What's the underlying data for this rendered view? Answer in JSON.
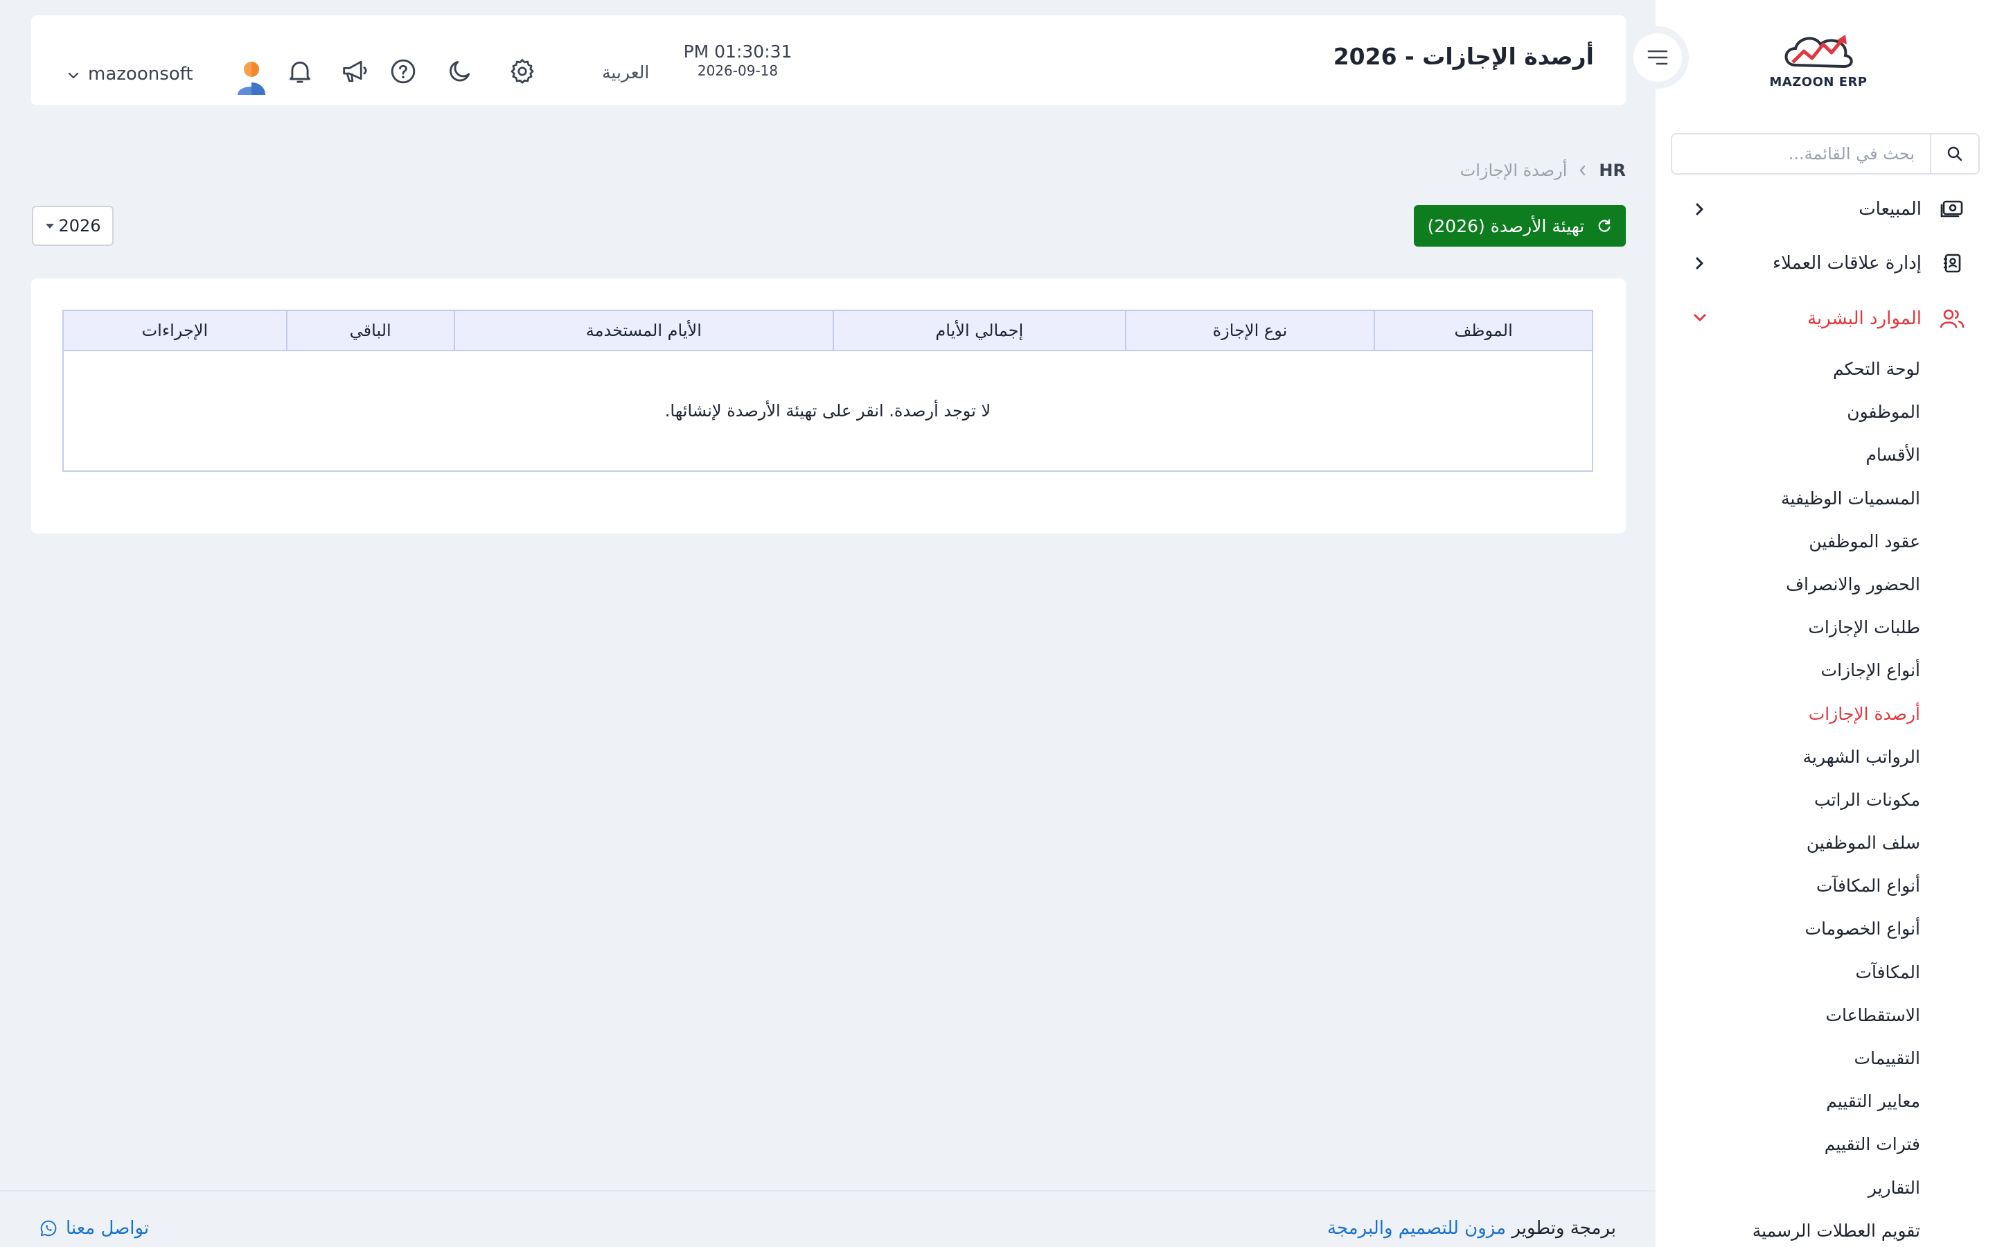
{
  "header": {
    "title": "أرصدة الإجازات - 2026",
    "clock_time": "PM 01:30:31",
    "clock_date": "2026-09-18",
    "language": "العربية",
    "user": "mazoonsoft"
  },
  "sidebar": {
    "logo_text": "MAZOON ERP",
    "search_placeholder": "بحث في القائمة...",
    "groups": [
      {
        "label": "المبيعات",
        "icon": "cash-icon"
      },
      {
        "label": "إدارة علاقات العملاء",
        "icon": "contacts-icon"
      },
      {
        "label": "الموارد البشرية",
        "icon": "users-icon",
        "active": true
      }
    ],
    "hr_items": [
      "لوحة التحكم",
      "الموظفون",
      "الأقسام",
      "المسميات الوظيفية",
      "عقود الموظفين",
      "الحضور والانصراف",
      "طلبات الإجازات",
      "أنواع الإجازات",
      "أرصدة الإجازات",
      "الرواتب الشهرية",
      "مكونات الراتب",
      "سلف الموظفين",
      "أنواع المكافآت",
      "أنواع الخصومات",
      "المكافآت",
      "الاستقطاعات",
      "التقييمات",
      "معايير التقييم",
      "فترات التقييم",
      "التقارير",
      "تقويم العطلات الرسمية"
    ],
    "active_item": "أرصدة الإجازات"
  },
  "breadcrumb": {
    "root": "HR",
    "current": "أرصدة الإجازات"
  },
  "actions": {
    "init_button": "تهيئة الأرصدة (2026)",
    "year": "2026"
  },
  "table": {
    "columns": [
      "الموظف",
      "نوع الإجازة",
      "إجمالي الأيام",
      "الأيام المستخدمة",
      "الباقي",
      "الإجراءات"
    ],
    "empty_message": "لا توجد أرصدة. انقر على تهيئة الأرصدة لإنشائها."
  },
  "footer": {
    "credit_prefix": "برمجة وتطوير",
    "credit_link": "مزون للتصميم والبرمجة",
    "contact": "تواصل معنا"
  },
  "colors": {
    "accent_red": "#e0383e",
    "button_green": "#0d7d1f",
    "link_blue": "#1a73c9",
    "table_header_bg": "#eceefe"
  }
}
